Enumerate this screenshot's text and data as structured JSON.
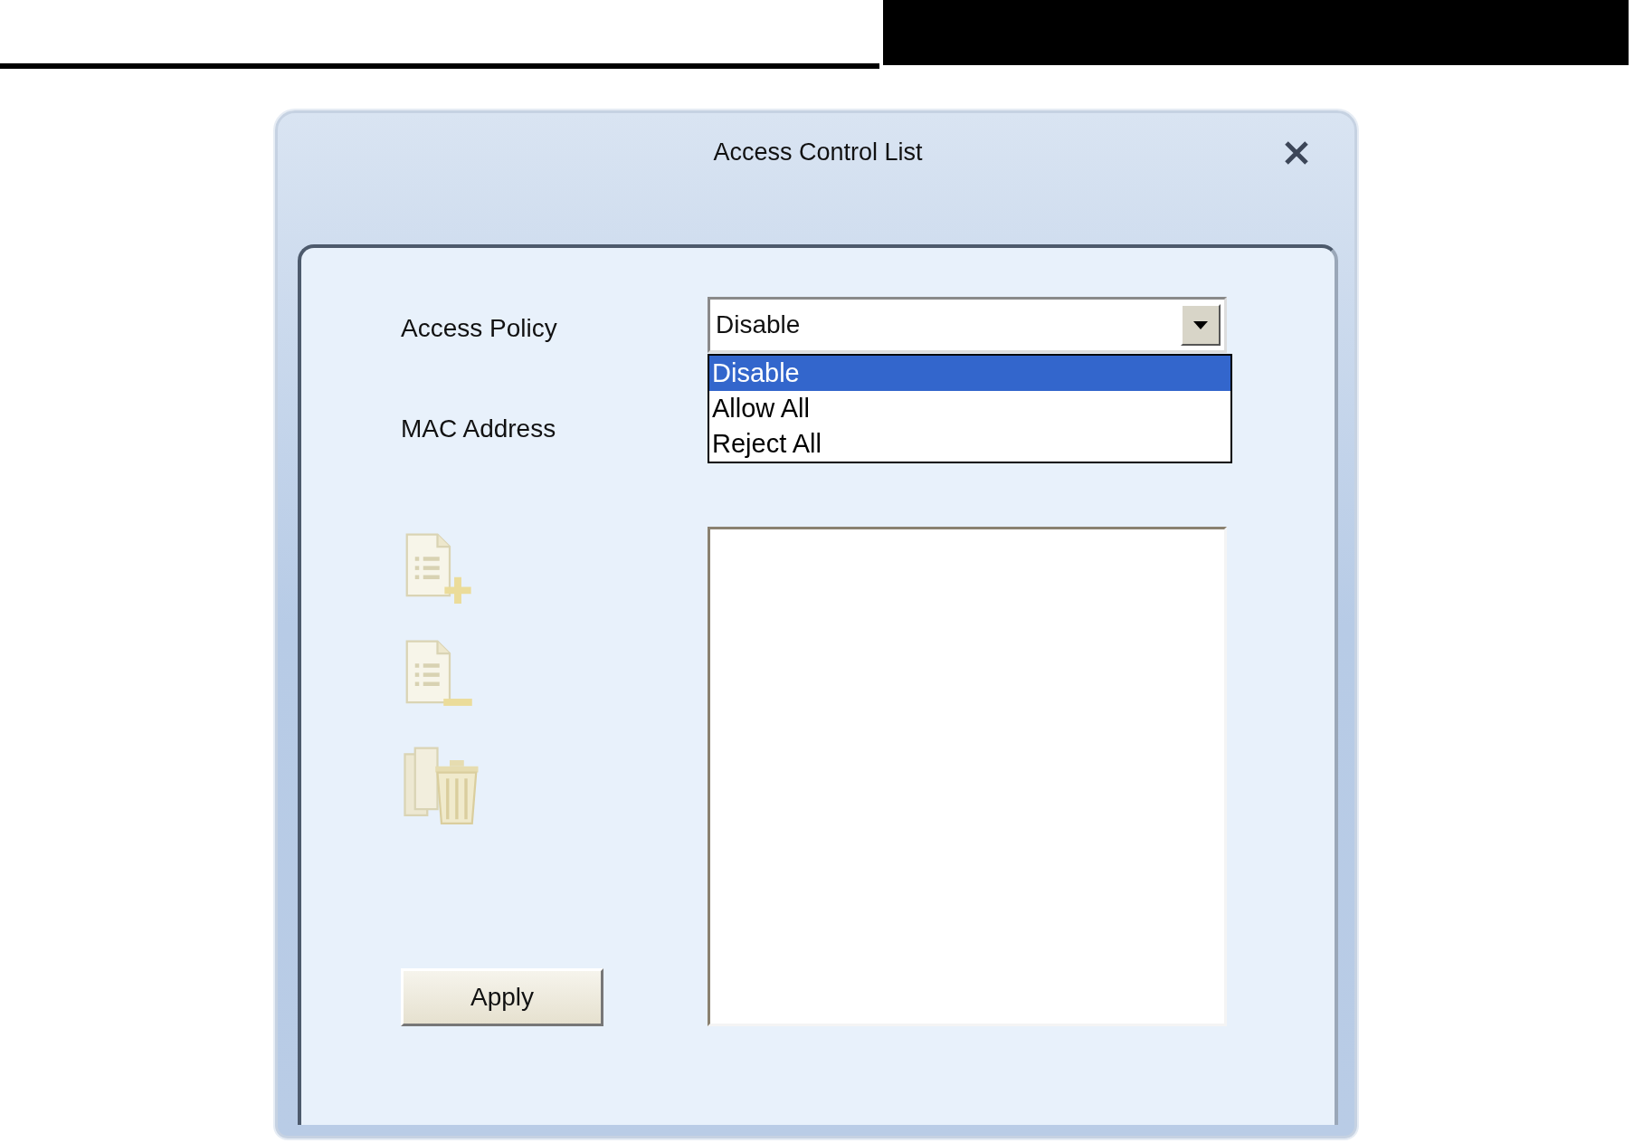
{
  "dialog": {
    "title": "Access Control List"
  },
  "access_policy": {
    "label": "Access Policy",
    "value": "Disable",
    "expanded": true,
    "options": [
      {
        "label": "Disable",
        "selected": true
      },
      {
        "label": "Allow All",
        "selected": false
      },
      {
        "label": "Reject All",
        "selected": false
      }
    ]
  },
  "mac_address": {
    "label": "MAC Address"
  },
  "tools": [
    {
      "kind": "add",
      "disabled": true
    },
    {
      "kind": "remove",
      "disabled": true
    },
    {
      "kind": "delete-all",
      "disabled": true
    }
  ],
  "apply_button": {
    "label": "Apply"
  }
}
